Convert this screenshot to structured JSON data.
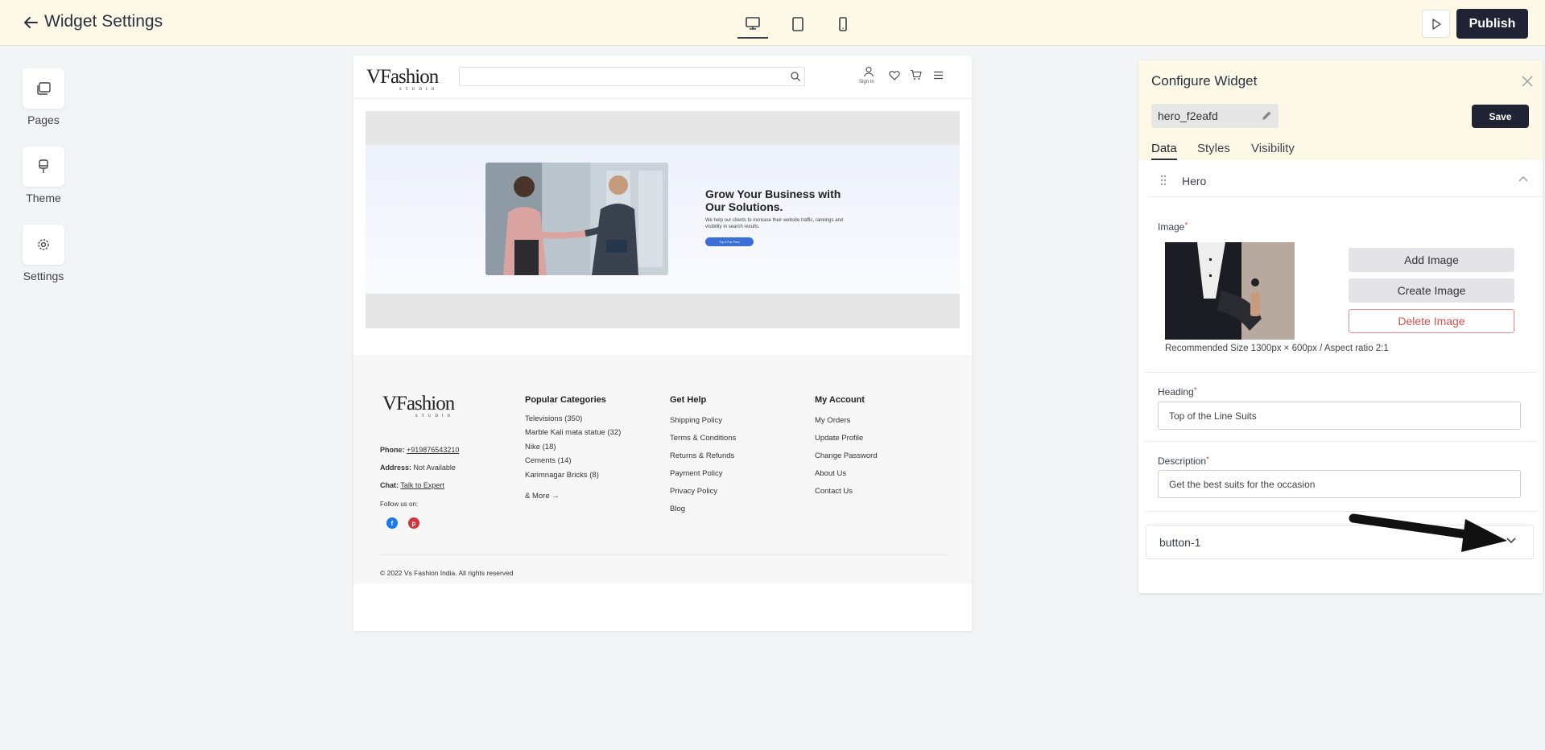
{
  "topbar": {
    "title": "Widget Settings",
    "publish_label": "Publish",
    "devices": [
      "desktop",
      "tablet",
      "mobile"
    ],
    "active_device": "desktop"
  },
  "rail": [
    {
      "label": "Pages",
      "icon": "pages-icon"
    },
    {
      "label": "Theme",
      "icon": "theme-icon"
    },
    {
      "label": "Settings",
      "icon": "gear-icon"
    }
  ],
  "site": {
    "logo_main": "VFashion",
    "logo_sub": "STUDIO",
    "signin": "Sign In",
    "hero": {
      "heading": "Grow Your Business with Our Solutions.",
      "description": "We help our clients to increase their website traffic, rankings and visibility in search results.",
      "cta": "Try It For Free"
    },
    "footer": {
      "phone_label": "Phone:",
      "phone": "+919876543210",
      "address_label": "Address:",
      "address": "Not Available",
      "chat_label": "Chat:",
      "chat": "Talk to Expert",
      "follow": "Follow us on:",
      "columns": [
        {
          "title": "Popular Categories",
          "items": [
            "Televisions (350)",
            "Marble Kali mata statue (32)",
            "Nike (18)",
            "Cements (14)",
            "Karimnagar Bricks (8)"
          ],
          "more": "& More →"
        },
        {
          "title": "Get Help",
          "items": [
            "Shipping Policy",
            "Terms & Conditions",
            "Returns & Refunds",
            "Payment Policy",
            "Privacy Policy",
            "Blog"
          ]
        },
        {
          "title": "My Account",
          "items": [
            "My Orders",
            "Update Profile",
            "Change Password",
            "About Us",
            "Contact Us"
          ]
        }
      ],
      "copyright": "© 2022 Vs Fashion India. All rights reserved"
    }
  },
  "panel": {
    "title": "Configure Widget",
    "widget_id": "hero_f2eafd",
    "save_label": "Save",
    "tabs": [
      "Data",
      "Styles",
      "Visibility"
    ],
    "active_tab": "Data",
    "section_label": "Hero",
    "image_label": "Image",
    "add_image": "Add Image",
    "create_image": "Create Image",
    "delete_image": "Delete Image",
    "recommended": "Recommended Size 1300px × 600px / Aspect ratio 2:1",
    "heading_label": "Heading",
    "heading_value": "Top of the Line Suits",
    "description_label": "Description",
    "description_value": "Get the best suits for the occasion",
    "button_section": "button-1",
    "required_mark": "*"
  },
  "colors": {
    "topbar_bg": "#fdf9e6",
    "primary_dark": "#1f2333",
    "delete_red": "#d95050",
    "hero_cta_blue": "#3b6fd8"
  }
}
